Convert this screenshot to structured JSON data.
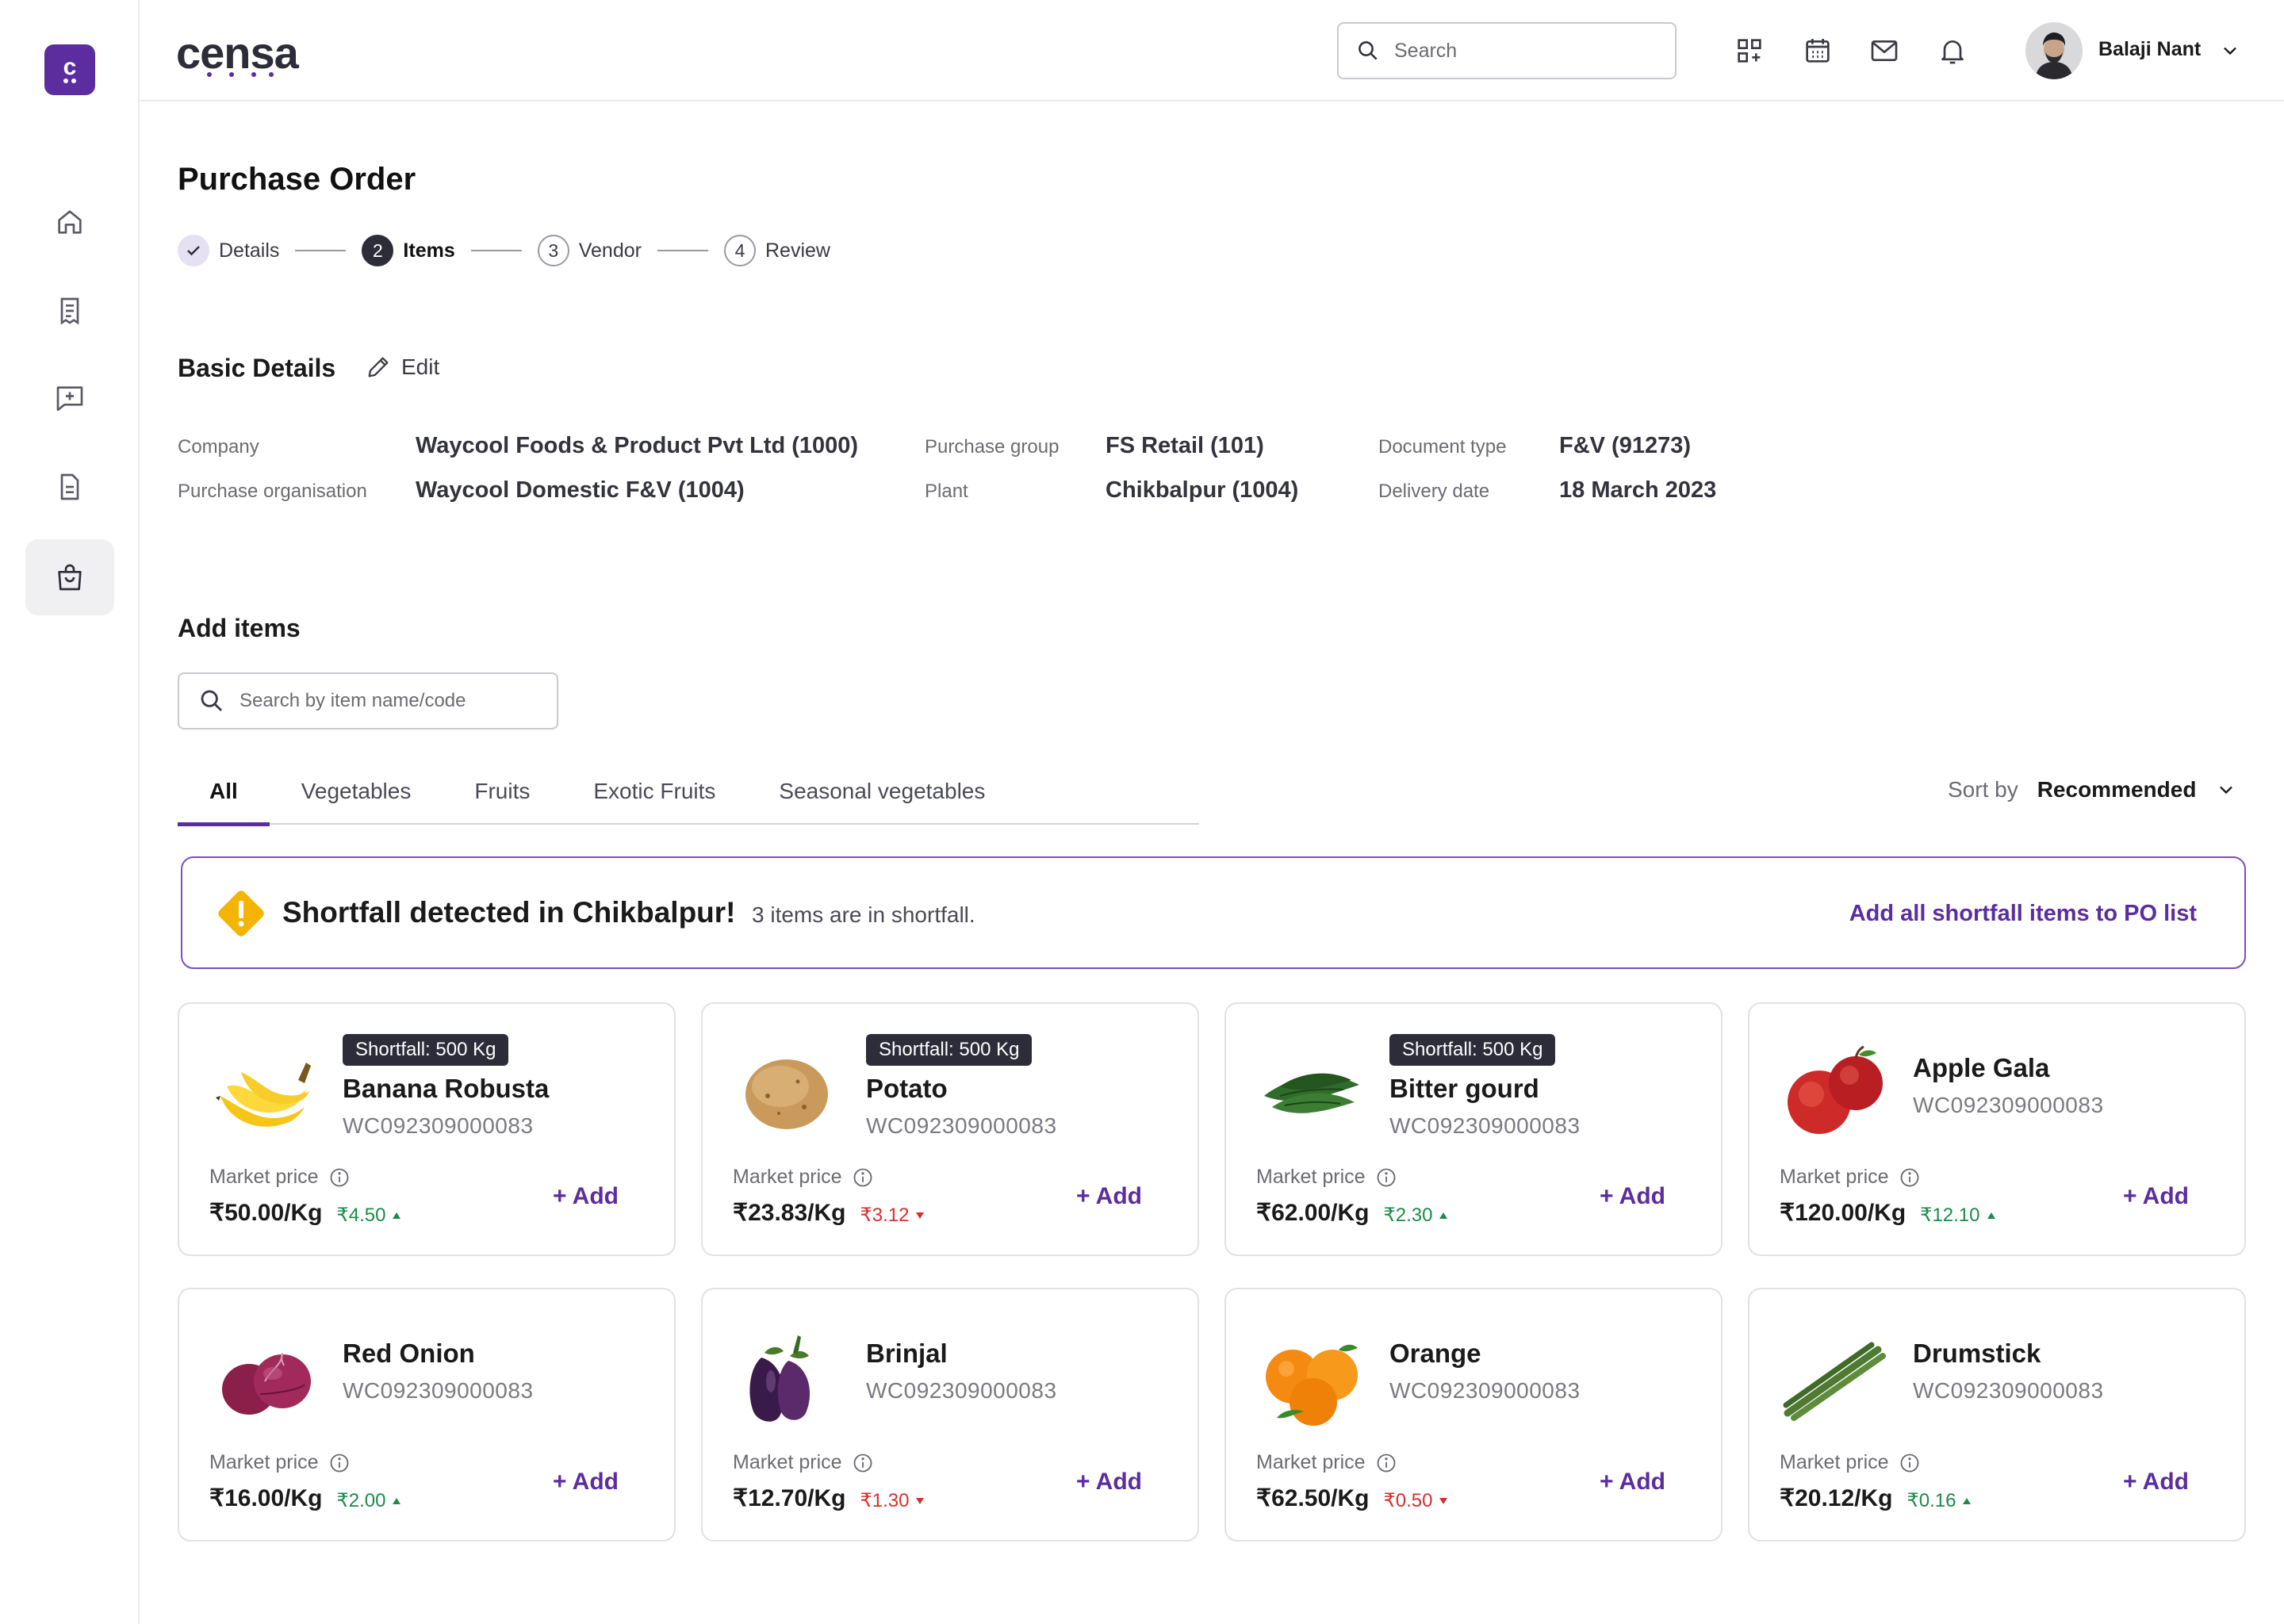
{
  "brand": {
    "name": "censa",
    "logo_letter": "c"
  },
  "top": {
    "search_placeholder": "Search",
    "user_name": "Balaji Nant"
  },
  "page": {
    "title": "Purchase Order"
  },
  "steps": [
    {
      "num": "1",
      "label": "Details",
      "state": "done"
    },
    {
      "num": "2",
      "label": "Items",
      "state": "current"
    },
    {
      "num": "3",
      "label": "Vendor",
      "state": "upcoming"
    },
    {
      "num": "4",
      "label": "Review",
      "state": "upcoming"
    }
  ],
  "basic": {
    "title": "Basic Details",
    "edit_label": "Edit",
    "company_label": "Company",
    "company": "Waycool Foods & Product Pvt Ltd (1000)",
    "porg_label": "Purchase organisation",
    "porg": "Waycool Domestic F&V (1004)",
    "pgroup_label": "Purchase group",
    "pgroup": "FS Retail (101)",
    "plant_label": "Plant",
    "plant": "Chikbalpur (1004)",
    "doctype_label": "Document type",
    "doctype": "F&V (91273)",
    "delivery_label": "Delivery date",
    "delivery": "18 March 2023"
  },
  "add_items": {
    "title": "Add items",
    "search_placeholder": "Search by item name/code",
    "tabs": [
      "All",
      "Vegetables",
      "Fruits",
      "Exotic Fruits",
      "Seasonal vegetables"
    ],
    "sort_label": "Sort by",
    "sort_value": "Recommended"
  },
  "banner": {
    "title": "Shortfall detected in Chikbalpur!",
    "sub": "3 items are in shortfall.",
    "link": "Add all shortfall items to PO list"
  },
  "market_price_label": "Market price",
  "add_label": "+ Add",
  "items": [
    {
      "name": "Banana Robusta",
      "code": "WC092309000083",
      "badge": "Shortfall: 500 Kg",
      "price": "₹50.00/Kg",
      "delta": "₹4.50",
      "dir": "up",
      "img": "banana"
    },
    {
      "name": "Potato",
      "code": "WC092309000083",
      "badge": "Shortfall: 500 Kg",
      "price": "₹23.83/Kg",
      "delta": "₹3.12",
      "dir": "down",
      "img": "potato"
    },
    {
      "name": "Bitter gourd",
      "code": "WC092309000083",
      "badge": "Shortfall: 500 Kg",
      "price": "₹62.00/Kg",
      "delta": "₹2.30",
      "dir": "up",
      "img": "bittergourd"
    },
    {
      "name": "Apple Gala",
      "code": "WC092309000083",
      "badge": "",
      "price": "₹120.00/Kg",
      "delta": "₹12.10",
      "dir": "up",
      "img": "apple"
    },
    {
      "name": "Red Onion",
      "code": "WC092309000083",
      "badge": "",
      "price": "₹16.00/Kg",
      "delta": "₹2.00",
      "dir": "up",
      "img": "onion"
    },
    {
      "name": "Brinjal",
      "code": "WC092309000083",
      "badge": "",
      "price": "₹12.70/Kg",
      "delta": "₹1.30",
      "dir": "down",
      "img": "brinjal"
    },
    {
      "name": "Orange",
      "code": "WC092309000083",
      "badge": "",
      "price": "₹62.50/Kg",
      "delta": "₹0.50",
      "dir": "down",
      "img": "orange"
    },
    {
      "name": "Drumstick",
      "code": "WC092309000083",
      "badge": "",
      "price": "₹20.12/Kg",
      "delta": "₹0.16",
      "dir": "up",
      "img": "drumstick"
    }
  ],
  "colors": {
    "accent": "#5b2d9e",
    "up": "#1d8a4a",
    "down": "#d62f2f",
    "warning": "#f5b400"
  }
}
